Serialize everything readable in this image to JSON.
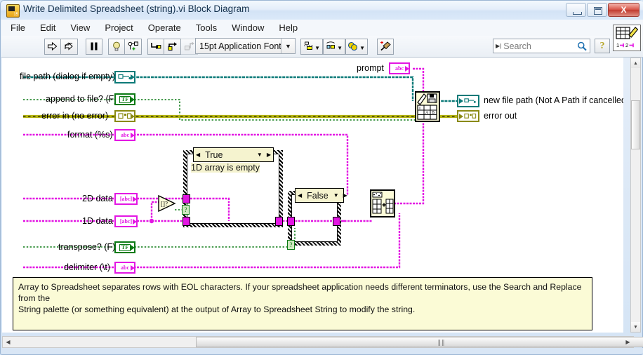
{
  "window": {
    "title": "Write Delimited Spreadsheet (string).vi Block Diagram",
    "icon_name": "labview-vi-icon",
    "icon_badge": "15",
    "minimize_label": "Minimize",
    "maximize_label": "Maximize",
    "close_label": "X"
  },
  "menubar": {
    "items": [
      {
        "label": "File"
      },
      {
        "label": "Edit"
      },
      {
        "label": "View"
      },
      {
        "label": "Project"
      },
      {
        "label": "Operate"
      },
      {
        "label": "Tools"
      },
      {
        "label": "Window"
      },
      {
        "label": "Help"
      }
    ]
  },
  "toolbar": {
    "run_icon": "run-arrow-icon",
    "run_continuous_icon": "run-continuously-icon",
    "pause_icon": "pause-icon",
    "highlight_icon": "highlight-execution-lightbulb-icon",
    "retain_values_icon": "retain-wire-values-icon",
    "step_into_icon": "step-into-icon",
    "step_over_icon": "step-over-icon",
    "step_out_icon": "step-out-icon",
    "font_label": "15pt Application Font",
    "font_dropdown_icon": "chevron-down-icon",
    "align_icon": "align-objects-icon",
    "distribute_icon": "distribute-objects-icon",
    "reorder_icon": "reorder-objects-icon",
    "cleanup_icon": "clean-up-diagram-icon",
    "search_placeholder": "Search",
    "search_value": "",
    "search_icon": "magnifier-icon",
    "search_scope_icon": "search-scope-icon",
    "help_icon": "context-help-question-icon",
    "grid_icon": "grid-edit-icon"
  },
  "diagram": {
    "inputs": [
      {
        "label": "file path (dialog if empty)",
        "type": "path",
        "glyph": "▭→"
      },
      {
        "label": "append to file? (F)",
        "type": "bool",
        "glyph": "TF"
      },
      {
        "label": "error in (no error)",
        "type": "error",
        "glyph": "▣■"
      },
      {
        "label": "format (%s)",
        "type": "string",
        "glyph": "abc"
      },
      {
        "label": "2D data",
        "type": "string",
        "glyph": "[abc]"
      },
      {
        "label": "1D data",
        "type": "string",
        "glyph": "[abc]"
      },
      {
        "label": "transpose? (F)",
        "type": "bool",
        "glyph": "TF"
      },
      {
        "label": "delimiter (\\t)",
        "type": "string",
        "glyph": "abc"
      }
    ],
    "top_input": {
      "label": "prompt",
      "type": "string",
      "glyph": "abc"
    },
    "outputs": [
      {
        "label": "new file path (Not A Path if cancelled)",
        "type": "path",
        "glyph": "▭→"
      },
      {
        "label": "error out",
        "type": "error",
        "glyph": "▣■"
      }
    ],
    "case_structures": [
      {
        "selector": "True",
        "label": "1D array is empty",
        "left_arrow": "◀",
        "right_arrow": "▶",
        "down_arrow": "▼"
      },
      {
        "selector": "False",
        "label": "",
        "left_arrow": "◀",
        "right_arrow": "▶",
        "down_arrow": "▼"
      }
    ],
    "nodes": [
      {
        "name": "empty-array-primitive",
        "glyph": "[ ]?"
      },
      {
        "name": "array-to-spreadsheet-string-node",
        "glyph": ""
      },
      {
        "name": "write-to-text-file-node",
        "glyph": ""
      }
    ],
    "comment": {
      "line1": "Array to Spreadsheet separates rows with EOL characters.  If your spreadsheet application needs different terminators, use the Search and Replace from the",
      "line2": "String palette (or something equivalent) at the output of Array to Spreadsheet String to modify the string."
    }
  },
  "scrollbars": {
    "v_up_icon": "triangle-up-icon",
    "v_down_icon": "triangle-down-icon",
    "h_left_icon": "triangle-left-icon",
    "h_right_icon": "triangle-right-icon",
    "h_grip": "‖‖"
  },
  "colors": {
    "string_wire": "#e316e3",
    "path_wire": "#0c7a78",
    "bool_wire": "#0b7a14",
    "error_wire": "#b3b312",
    "comment_bg": "#fbfbd6",
    "case_header_bg": "#f5f3cf"
  }
}
